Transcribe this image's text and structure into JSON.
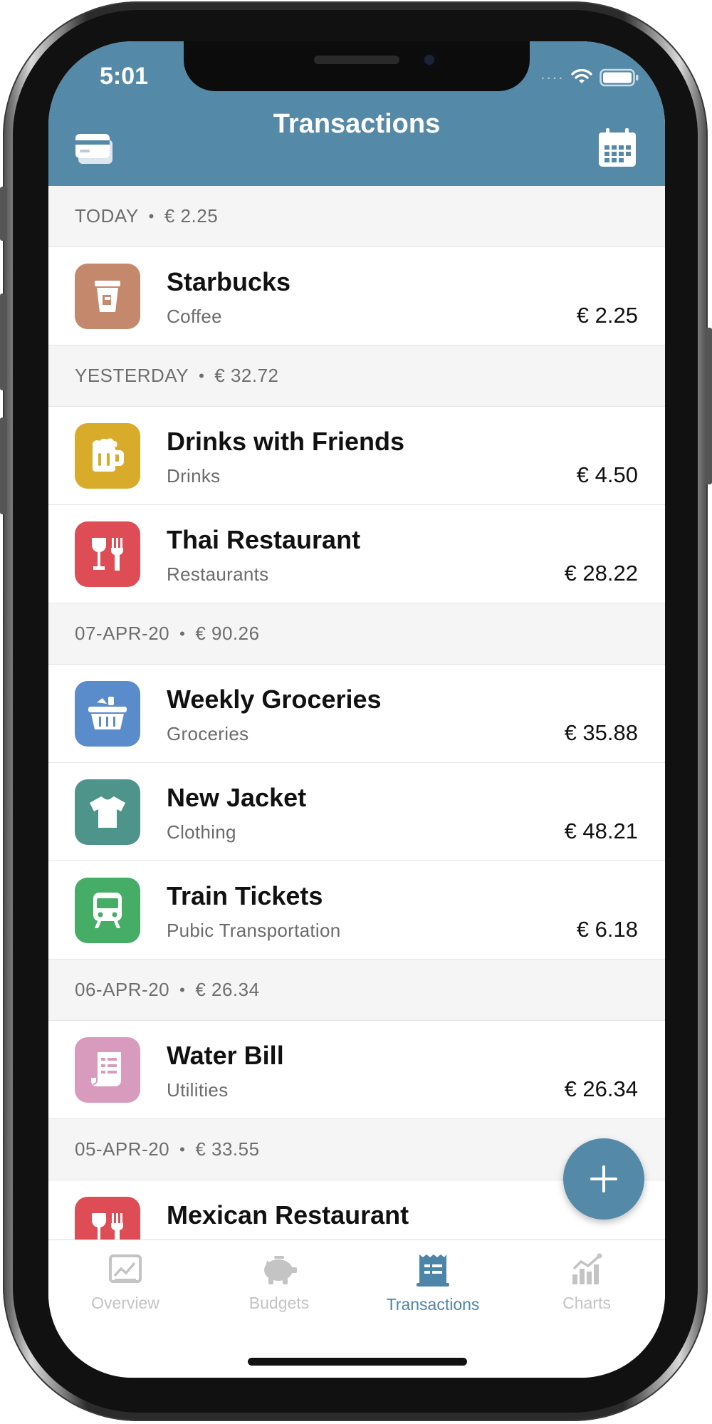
{
  "status_bar": {
    "time": "5:01"
  },
  "header": {
    "title": "Transactions"
  },
  "colors": {
    "header_bg": "#5589a8",
    "accent": "#4d85a8"
  },
  "sections": [
    {
      "date": "TODAY",
      "total": "€ 2.25",
      "rows": [
        {
          "name": "Starbucks",
          "category": "Coffee",
          "amount": "€ 2.25",
          "icon": "coffee-cup-icon",
          "color": "#c4886c"
        }
      ]
    },
    {
      "date": "YESTERDAY",
      "total": "€ 32.72",
      "rows": [
        {
          "name": "Drinks with Friends",
          "category": "Drinks",
          "amount": "€ 4.50",
          "icon": "beer-mug-icon",
          "color": "#d8ac2a"
        },
        {
          "name": "Thai Restaurant",
          "category": "Restaurants",
          "amount": "€ 28.22",
          "icon": "wine-fork-icon",
          "color": "#de4d55"
        }
      ]
    },
    {
      "date": "07-APR-20",
      "total": "€ 90.26",
      "rows": [
        {
          "name": "Weekly Groceries",
          "category": "Groceries",
          "amount": "€ 35.88",
          "icon": "shopping-basket-icon",
          "color": "#5a8ccc"
        },
        {
          "name": "New Jacket",
          "category": "Clothing",
          "amount": "€ 48.21",
          "icon": "t-shirt-icon",
          "color": "#4f948a"
        },
        {
          "name": "Train Tickets",
          "category": "Pubic Transportation",
          "amount": "€ 6.18",
          "icon": "train-icon",
          "color": "#45ad66"
        }
      ]
    },
    {
      "date": "06-APR-20",
      "total": "€ 26.34",
      "rows": [
        {
          "name": "Water Bill",
          "category": "Utilities",
          "amount": "€ 26.34",
          "icon": "receipt-icon",
          "color": "#d89bbd"
        }
      ]
    },
    {
      "date": "05-APR-20",
      "total": "€ 33.55",
      "rows": [
        {
          "name": "Mexican Restaurant",
          "category": "",
          "amount": "",
          "icon": "wine-fork-icon",
          "color": "#de4d55"
        }
      ]
    }
  ],
  "tabs": [
    {
      "label": "Overview",
      "icon": "overview-chart-icon",
      "active": false
    },
    {
      "label": "Budgets",
      "icon": "piggy-bank-icon",
      "active": false
    },
    {
      "label": "Transactions",
      "icon": "receipt-list-icon",
      "active": true
    },
    {
      "label": "Charts",
      "icon": "bar-chart-icon",
      "active": false
    }
  ],
  "fab": {
    "icon": "plus-icon"
  }
}
